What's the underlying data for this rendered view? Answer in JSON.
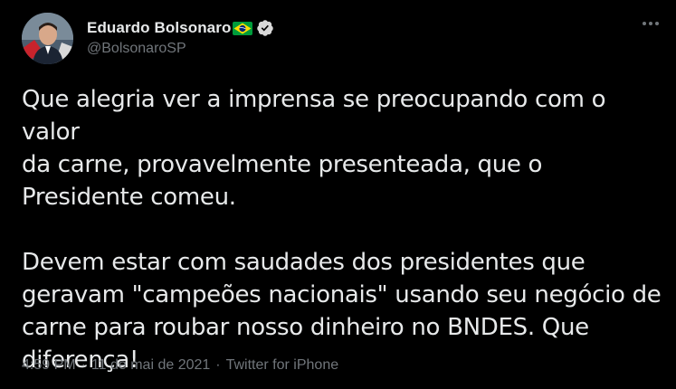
{
  "tweet": {
    "display_name": "Eduardo Bolsonaro",
    "handle": "@BolsonaroSP",
    "text": "Que alegria ver a imprensa se preocupando com o valor\nda carne, provavelmente presenteada, que o\nPresidente comeu.\n\nDevem estar com saudades dos presidentes que\ngeravam \"campeões nacionais\" usando seu negócio de\ncarne para roubar nosso dinheiro no BNDES. Que\ndiferença!",
    "time": "4:59 PM",
    "date": "11 de mai de 2021",
    "source": "Twitter for iPhone",
    "separator": "·"
  },
  "icons": {
    "flag": "brazil-flag-icon",
    "verified": "verified-badge-icon",
    "more": "more-options-icon"
  },
  "colors": {
    "background": "#000000",
    "text_primary": "#e7e9ea",
    "text_secondary": "#71767b",
    "flag_green": "#009c3b",
    "flag_yellow": "#ffdf00",
    "flag_blue": "#002776"
  }
}
